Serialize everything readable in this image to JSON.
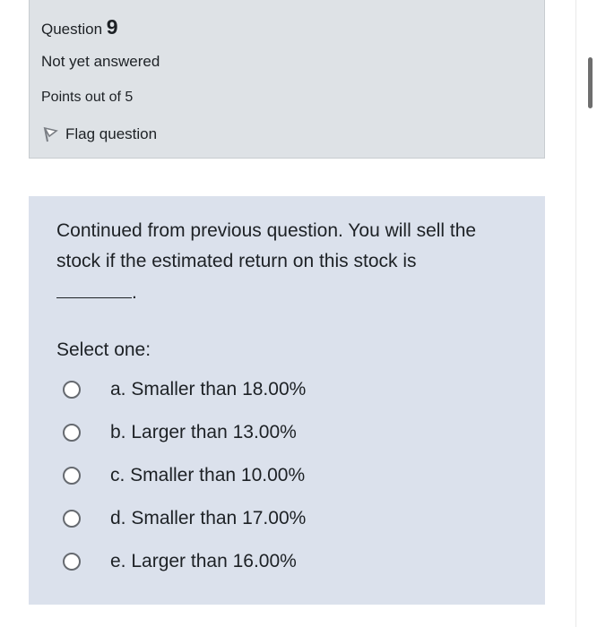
{
  "question_info": {
    "label": "Question",
    "number": "9",
    "state": "Not yet answered",
    "grade": "Points out of 5",
    "flag_label": "Flag question"
  },
  "question": {
    "text": "Continued from previous question. You will sell the stock if the estimated return on this stock is",
    "blank_suffix": ".",
    "prompt": "Select one:",
    "options": [
      {
        "label": "a. Smaller than 18.00%"
      },
      {
        "label": "b. Larger than 13.00%"
      },
      {
        "label": "c. Smaller than 10.00%"
      },
      {
        "label": "d. Smaller than 17.00%"
      },
      {
        "label": "e. Larger than 16.00%"
      }
    ]
  },
  "colors": {
    "info_bg": "#dee2e6",
    "content_bg": "#dbe1ec",
    "text": "#1d2125"
  }
}
